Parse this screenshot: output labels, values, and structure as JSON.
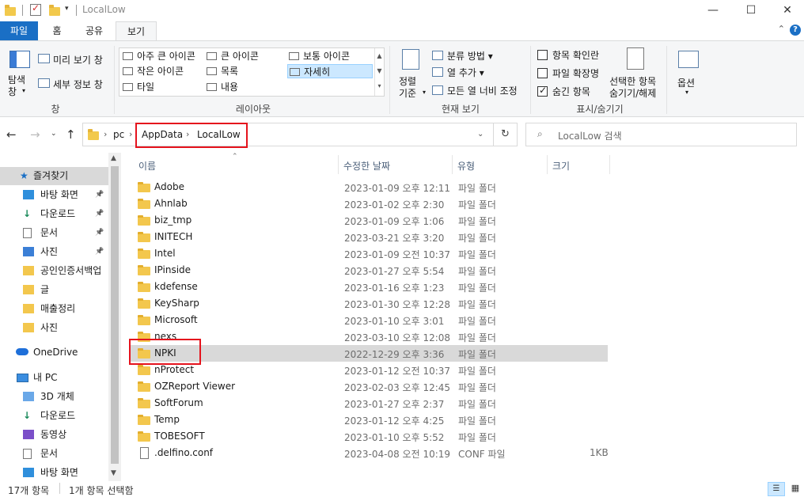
{
  "window": {
    "title": "LocalLow",
    "minimize": "—",
    "maximize": "☐",
    "close": "✕"
  },
  "ribbon_tabs": [
    "파일",
    "홈",
    "공유",
    "보기"
  ],
  "ribbon": {
    "pane_group": {
      "nav_pane": "탐색\n창",
      "preview": "미리 보기 창",
      "details": "세부 정보 창",
      "label": "창"
    },
    "layout_group": {
      "items": [
        "아주 큰 아이콘",
        "큰 아이콘",
        "보통 아이콘",
        "작은 아이콘",
        "목록",
        "자세히",
        "타일",
        "내용"
      ],
      "selected": "자세히",
      "label": "레이아웃"
    },
    "view_group": {
      "sort_by": "정렬\n기준",
      "group_by": "분류 방법",
      "add_columns": "열 추가",
      "fit_columns": "모든 열 너비 조정",
      "label": "현재 보기"
    },
    "showhide_group": {
      "item_checkboxes": "항목 확인란",
      "file_extensions": "파일 확장명",
      "hidden_items": "숨긴 항목",
      "hide_selected": "선택한 항목\n숨기기/해제",
      "label": "표시/숨기기"
    },
    "options": "옵션"
  },
  "address": {
    "crumbs": [
      "pc",
      "AppData",
      "LocalLow"
    ],
    "search_placeholder": "LocalLow 검색"
  },
  "sidebar": {
    "quick_access": "즐겨찾기",
    "items": [
      {
        "label": "바탕 화면",
        "icon": "desktop-icon",
        "pinned": true
      },
      {
        "label": "다운로드",
        "icon": "download-icon",
        "pinned": true
      },
      {
        "label": "문서",
        "icon": "document-icon",
        "pinned": true
      },
      {
        "label": "사진",
        "icon": "pictures-icon",
        "pinned": true
      },
      {
        "label": "공인인증서백업",
        "icon": "folder-icon",
        "pinned": false
      },
      {
        "label": "글",
        "icon": "folder-icon",
        "pinned": false
      },
      {
        "label": "매출정리",
        "icon": "folder-icon",
        "pinned": false
      },
      {
        "label": "사진",
        "icon": "folder-icon",
        "pinned": false
      }
    ],
    "onedrive": "OneDrive",
    "this_pc": "내 PC",
    "pc_items": [
      {
        "label": "3D 개체",
        "icon": "3d-objects-icon"
      },
      {
        "label": "다운로드",
        "icon": "download-icon"
      },
      {
        "label": "동영상",
        "icon": "video-icon"
      },
      {
        "label": "문서",
        "icon": "document-icon"
      },
      {
        "label": "바탕 화면",
        "icon": "desktop-icon"
      }
    ]
  },
  "columns": {
    "name": "이름",
    "modified": "수정한 날짜",
    "type": "유형",
    "size": "크기"
  },
  "files": [
    {
      "name": "Adobe",
      "modified": "2023-01-09 오후 12:11",
      "type": "파일 폴더",
      "size": "",
      "kind": "folder"
    },
    {
      "name": "Ahnlab",
      "modified": "2023-01-02 오후 2:30",
      "type": "파일 폴더",
      "size": "",
      "kind": "folder"
    },
    {
      "name": "biz_tmp",
      "modified": "2023-01-09 오후 1:06",
      "type": "파일 폴더",
      "size": "",
      "kind": "folder"
    },
    {
      "name": "INITECH",
      "modified": "2023-03-21 오후 3:20",
      "type": "파일 폴더",
      "size": "",
      "kind": "folder"
    },
    {
      "name": "Intel",
      "modified": "2023-01-09 오전 10:37",
      "type": "파일 폴더",
      "size": "",
      "kind": "folder"
    },
    {
      "name": "IPinside",
      "modified": "2023-01-27 오후 5:54",
      "type": "파일 폴더",
      "size": "",
      "kind": "folder"
    },
    {
      "name": "kdefense",
      "modified": "2023-01-16 오후 1:23",
      "type": "파일 폴더",
      "size": "",
      "kind": "folder"
    },
    {
      "name": "KeySharp",
      "modified": "2023-01-30 오후 12:28",
      "type": "파일 폴더",
      "size": "",
      "kind": "folder"
    },
    {
      "name": "Microsoft",
      "modified": "2023-01-10 오후 3:01",
      "type": "파일 폴더",
      "size": "",
      "kind": "folder"
    },
    {
      "name": "nexs",
      "modified": "2023-03-10 오후 12:08",
      "type": "파일 폴더",
      "size": "",
      "kind": "folder"
    },
    {
      "name": "NPKI",
      "modified": "2022-12-29 오후 3:36",
      "type": "파일 폴더",
      "size": "",
      "kind": "folder",
      "selected": true
    },
    {
      "name": "nProtect",
      "modified": "2023-01-12 오전 10:37",
      "type": "파일 폴더",
      "size": "",
      "kind": "folder"
    },
    {
      "name": "OZReport Viewer",
      "modified": "2023-02-03 오후 12:45",
      "type": "파일 폴더",
      "size": "",
      "kind": "folder"
    },
    {
      "name": "SoftForum",
      "modified": "2023-01-27 오후 2:37",
      "type": "파일 폴더",
      "size": "",
      "kind": "folder"
    },
    {
      "name": "Temp",
      "modified": "2023-01-12 오후 4:25",
      "type": "파일 폴더",
      "size": "",
      "kind": "folder"
    },
    {
      "name": "TOBESOFT",
      "modified": "2023-01-10 오후 5:52",
      "type": "파일 폴더",
      "size": "",
      "kind": "folder"
    },
    {
      "name": ".delfino.conf",
      "modified": "2023-04-08 오전 10:19",
      "type": "CONF 파일",
      "size": "1KB",
      "kind": "file"
    }
  ],
  "status": {
    "count": "17개 항목",
    "selected": "1개 항목 선택함"
  },
  "colors": {
    "accent": "#1a6fc5",
    "highlight": "#e5131d",
    "selection": "#d9d9d9"
  }
}
